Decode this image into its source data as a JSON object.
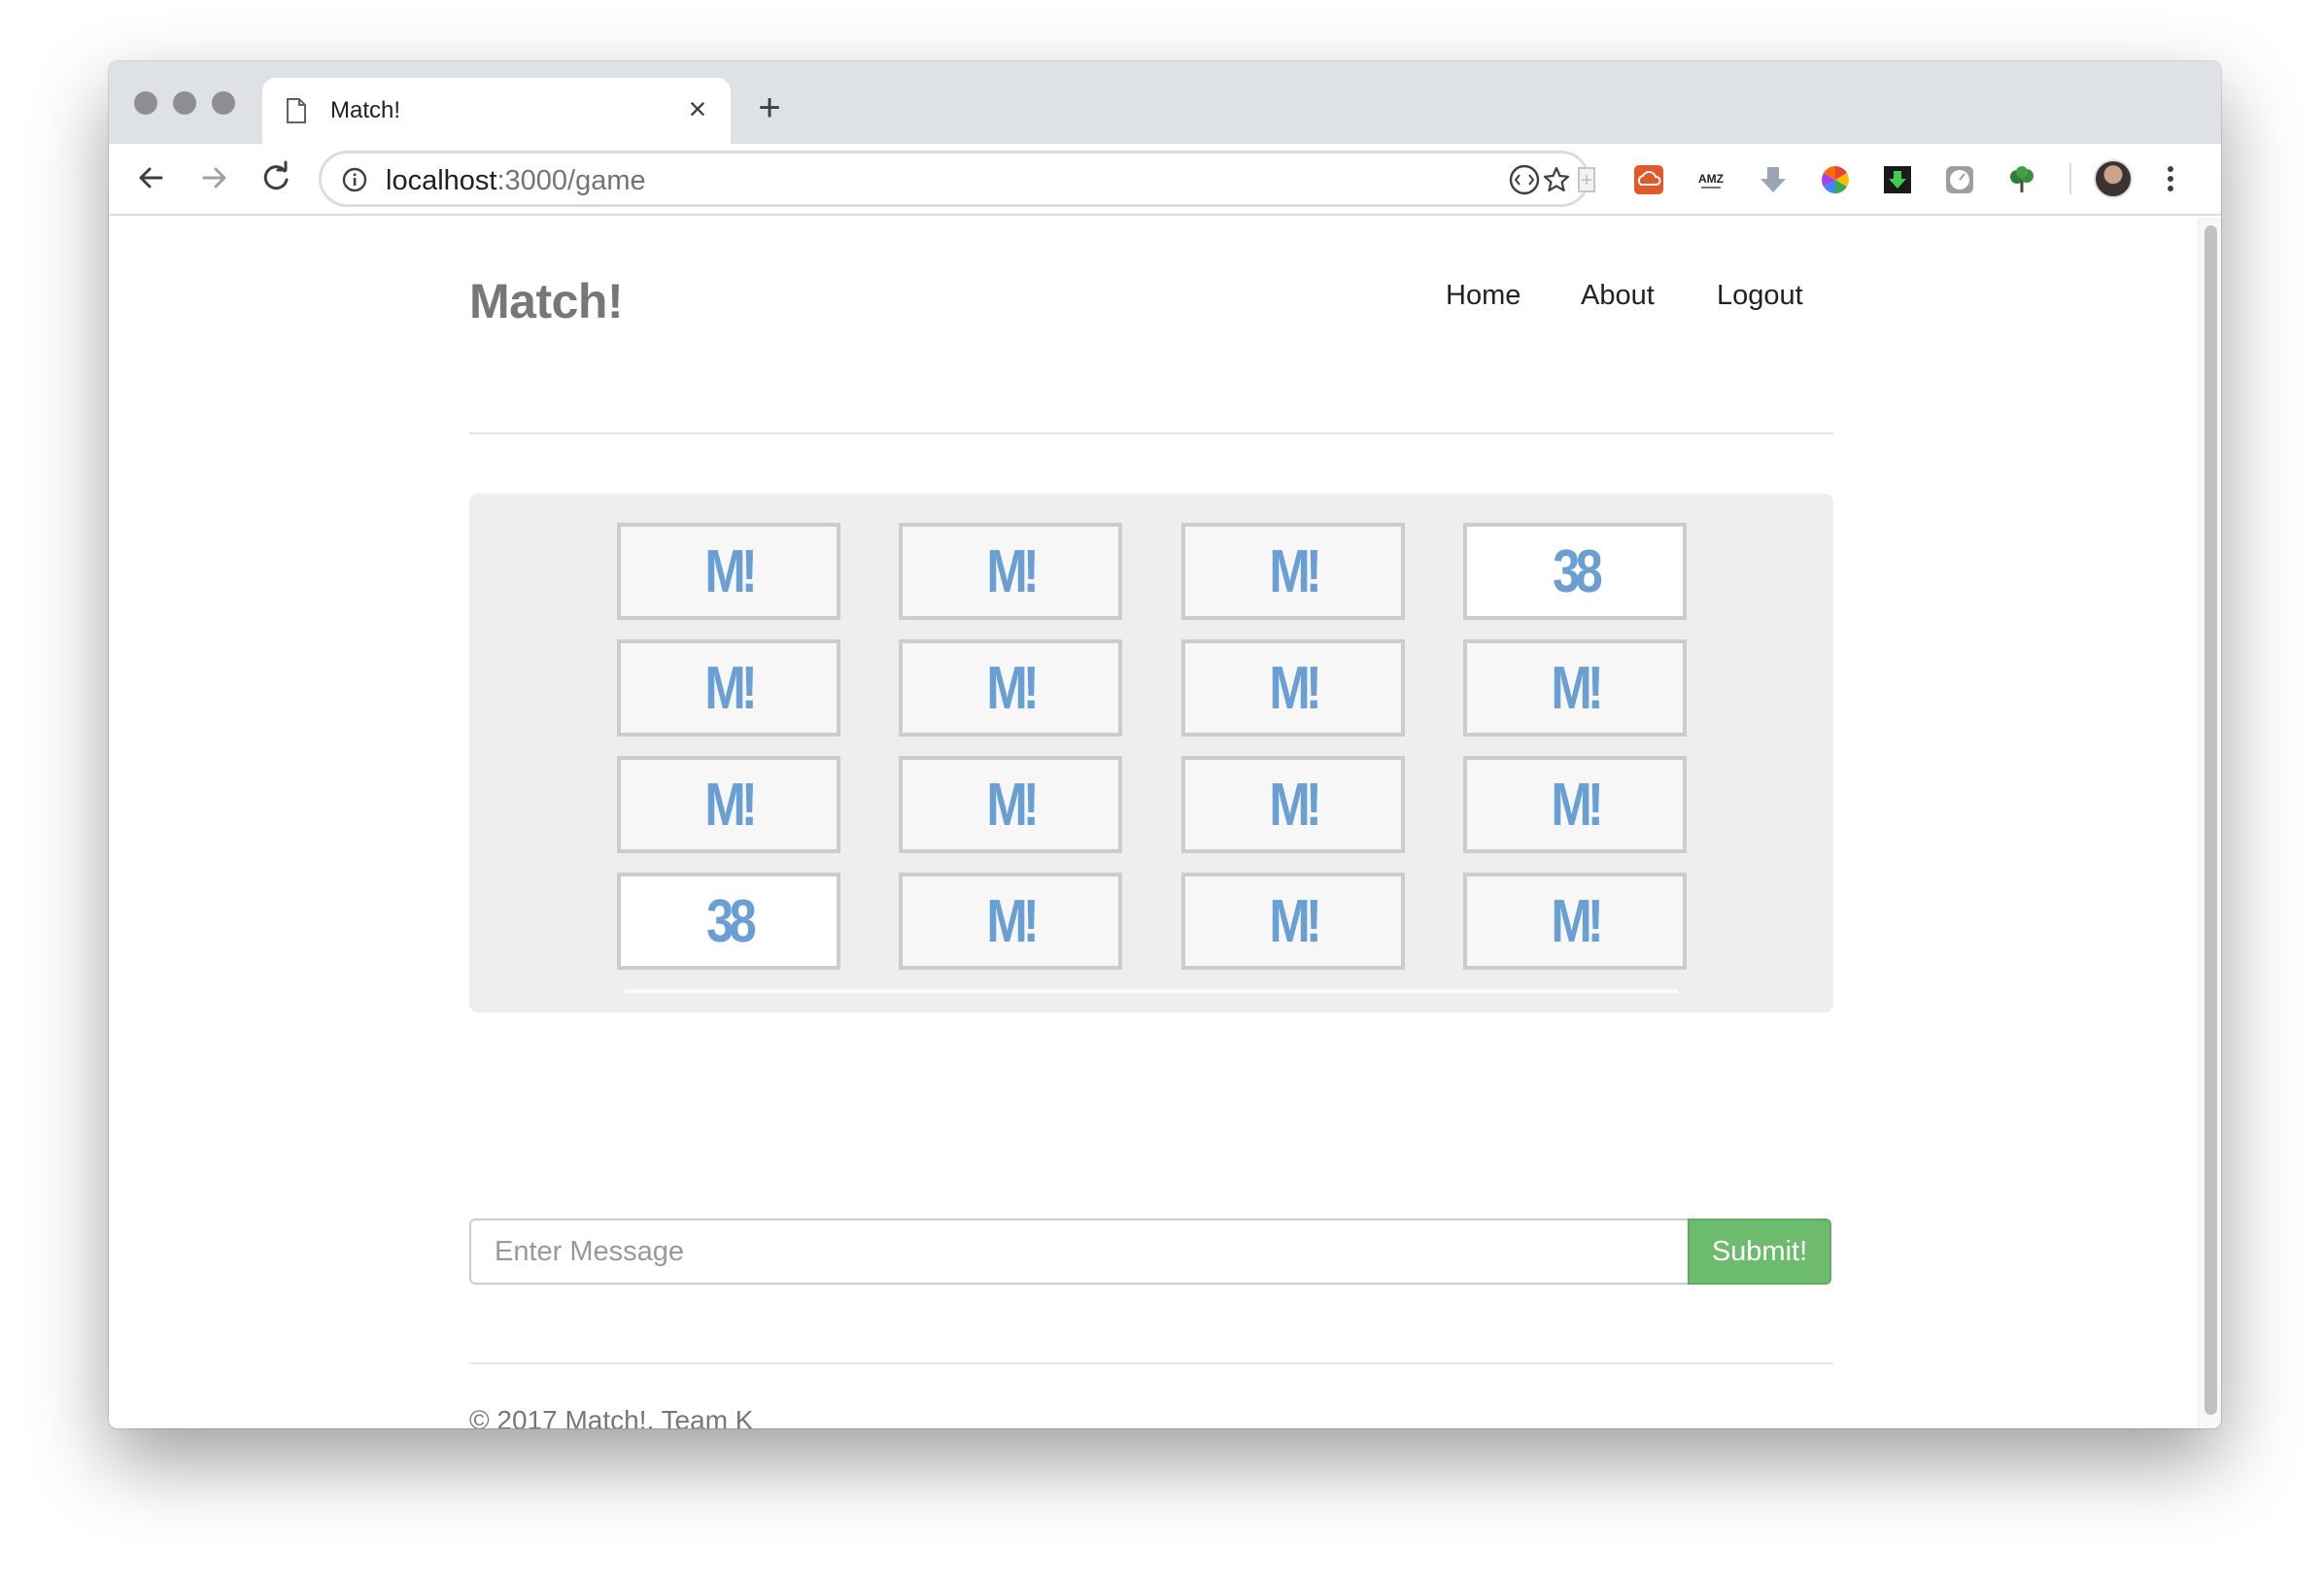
{
  "browser": {
    "tab_title": "Match!",
    "tab_close": "×",
    "new_tab": "+",
    "url_host": "localhost",
    "url_path": ":3000/game"
  },
  "header": {
    "brand": "Match!",
    "nav": [
      "Home",
      "About",
      "Logout"
    ]
  },
  "board": {
    "rows": [
      [
        "M!",
        "M!",
        "M!",
        "38"
      ],
      [
        "M!",
        "M!",
        "M!",
        "M!"
      ],
      [
        "M!",
        "M!",
        "M!",
        "M!"
      ],
      [
        "38",
        "M!",
        "M!",
        "M!"
      ]
    ],
    "revealed_color": "#6a9fd4"
  },
  "chat": {
    "placeholder": "Enter Message",
    "submit_label": "Submit!"
  },
  "footer": {
    "text": "© 2017 Match!, Team K"
  },
  "colors": {
    "submit": "#6dbb6d",
    "card_text": "#6a9fd4"
  },
  "icons": [
    "page-icon",
    "close-icon",
    "plus-icon",
    "back-arrow-icon",
    "forward-arrow-icon",
    "reload-icon",
    "info-icon",
    "star-icon",
    "more-vert-icon"
  ]
}
